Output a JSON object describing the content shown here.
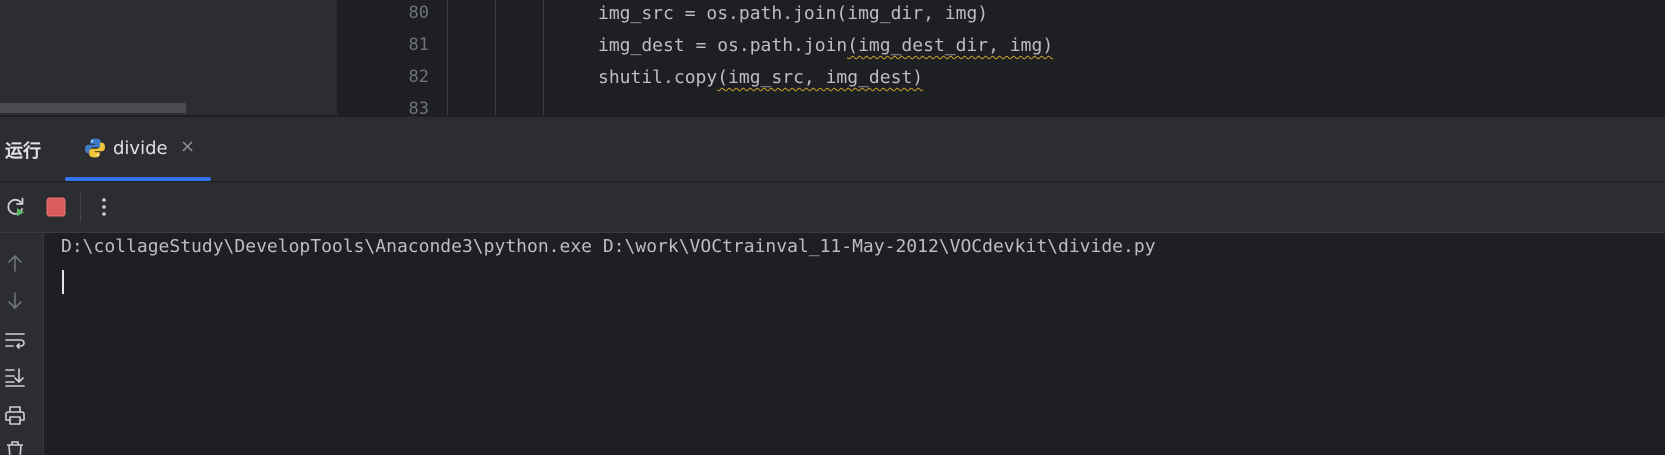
{
  "editor": {
    "lines": [
      {
        "number": "80",
        "code_pre": "img_src = os.path.join(img_dir, img)",
        "code_warn": "",
        "code_post": ""
      },
      {
        "number": "81",
        "code_pre": "img_dest = os.path.join",
        "code_warn": "(img_dest_dir, img)",
        "code_post": ""
      },
      {
        "number": "82",
        "code_pre": "shutil.copy",
        "code_warn": "(img_src, img_dest)",
        "code_post": ""
      },
      {
        "number": "83",
        "code_pre": "",
        "code_warn": "",
        "code_post": ""
      }
    ]
  },
  "run_window": {
    "title": "运行",
    "tab": {
      "label": "divide",
      "close_glyph": "×"
    },
    "console": {
      "command": "D:\\collageStudy\\DevelopTools\\Anaconde3\\python.exe D:\\work\\VOCtrainval_11-May-2012\\VOCdevkit\\divide.py"
    }
  },
  "icons": {
    "rerun": "rerun-icon",
    "stop": "stop-icon",
    "more": "more-vertical-icon",
    "scroll_up": "arrow-up-icon",
    "scroll_down": "arrow-down-icon",
    "soft_wrap": "soft-wrap-icon",
    "scroll_to_end": "scroll-to-end-icon",
    "print": "print-icon",
    "clear": "trash-icon",
    "python": "python-icon"
  },
  "colors": {
    "accent": "#3574f0",
    "run_green": "#5fb865",
    "stop_red": "#db5c5c",
    "warning_underline": "#c9a22d"
  }
}
